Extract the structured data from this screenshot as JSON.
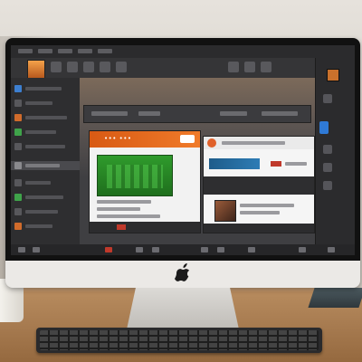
{
  "scene": {
    "description_colors": {
      "wall": "#ddd8d0",
      "desk": "#a97d52",
      "monitor_frame": "#ebe9e6",
      "screen_bg": "#3a3a3c",
      "accent_orange": "#e8682a",
      "accent_green": "#2f9b2c",
      "accent_blue": "#2f7ad6",
      "accent_red": "#c0392b"
    }
  },
  "monitor": {
    "logo_icon": "apple-logo-icon"
  },
  "screen_app": {
    "left_card": {
      "header_text": "••• •••"
    }
  },
  "icons": {
    "menu": "menu-icon",
    "tool": "tool-icon",
    "color_swatch": "color-swatch-icon",
    "photo_thumbnail": "photo-thumbnail-icon"
  }
}
